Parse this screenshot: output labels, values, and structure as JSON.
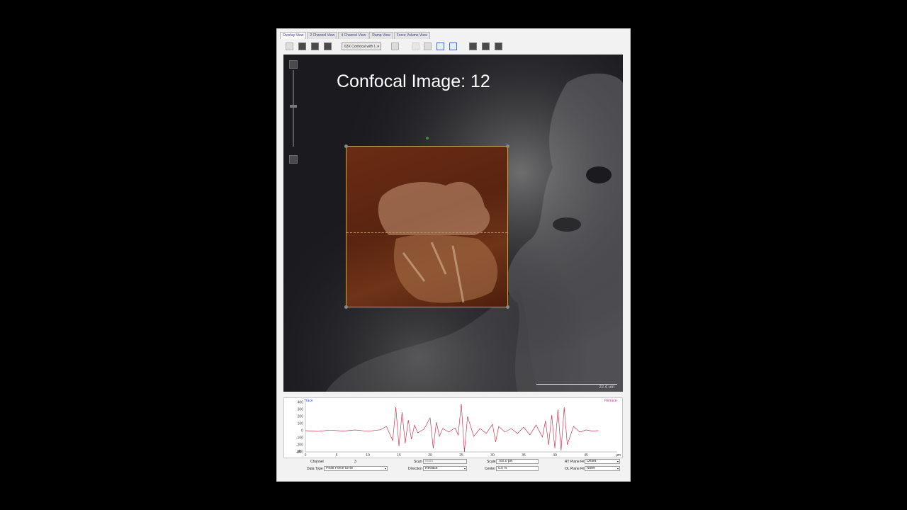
{
  "tabs": [
    {
      "label": "Overlay View",
      "active": true
    },
    {
      "label": "2 Channel View"
    },
    {
      "label": "4 Channel View"
    },
    {
      "label": "Ramp View"
    },
    {
      "label": "Force Volume View"
    }
  ],
  "toolbar": {
    "objective_select": "63X Confocal with I...",
    "icons": [
      "image-icon",
      "overlay-icon",
      "square-dot-icon",
      "frame-icon",
      "camera-icon",
      "blank-icon",
      "pointer-icon",
      "select-rect-icon",
      "move-icon",
      "edit-pen-icon",
      "draw-icon",
      "brush-icon"
    ]
  },
  "viewer": {
    "title": "Confocal Image: 12",
    "scale_bar_label": "22.4 um"
  },
  "chart_data": {
    "type": "line",
    "legend_left": "Trace",
    "legend_right": "Retrace",
    "ylim": [
      -300,
      400
    ],
    "yticks": [
      "400",
      "300",
      "200",
      "100",
      "0",
      "-100",
      "-200",
      "-300"
    ],
    "ylabel": "pN",
    "xlim": [
      0,
      50
    ],
    "xticks": [
      "0",
      "5",
      "10",
      "15",
      "20",
      "25",
      "30",
      "35",
      "40",
      "45"
    ],
    "xlabel": "µm",
    "series": [
      {
        "name": "Trace",
        "color": "#c83a50",
        "x": [
          0,
          2,
          4,
          6,
          8,
          10,
          12,
          13,
          14,
          14.5,
          15,
          15.5,
          16,
          16.5,
          17,
          17.5,
          18,
          19,
          20,
          20.5,
          21,
          21.5,
          22,
          23,
          24,
          24.5,
          25,
          25.5,
          26,
          27,
          28,
          29,
          30,
          30.5,
          31,
          32,
          33,
          34,
          35,
          36,
          37,
          38,
          38.5,
          39,
          39.5,
          40,
          40.5,
          41,
          41.5,
          42,
          43,
          44,
          45,
          46,
          47
        ],
        "y": [
          0,
          -10,
          8,
          -6,
          10,
          -8,
          12,
          60,
          -140,
          330,
          -220,
          260,
          -180,
          150,
          -120,
          80,
          -30,
          20,
          180,
          -250,
          120,
          -80,
          30,
          -20,
          40,
          -60,
          380,
          -300,
          200,
          -80,
          30,
          -40,
          90,
          -160,
          60,
          -20,
          30,
          -40,
          50,
          -60,
          80,
          -90,
          140,
          -200,
          220,
          -250,
          300,
          -280,
          330,
          -200,
          60,
          -20,
          10,
          -5,
          0
        ]
      }
    ]
  },
  "controls": {
    "channel_label": "Channel",
    "channel_value": "3",
    "data_type_label": "Data Type",
    "data_type_value": "Peak Force Error",
    "scan_label": "Scan",
    "scan_value": "Main",
    "direction_label": "Direction",
    "direction_value": "Retrace",
    "scale_label": "Scale",
    "scale_value": "700.0 pN",
    "center_label": "Center",
    "center_value": "0.0 N",
    "rt_plane_fit_label": "RT Plane Fit",
    "rt_plane_fit_value": "Offset",
    "ol_plane_fit_label": "OL Plane Fit",
    "ol_plane_fit_value": "None"
  }
}
